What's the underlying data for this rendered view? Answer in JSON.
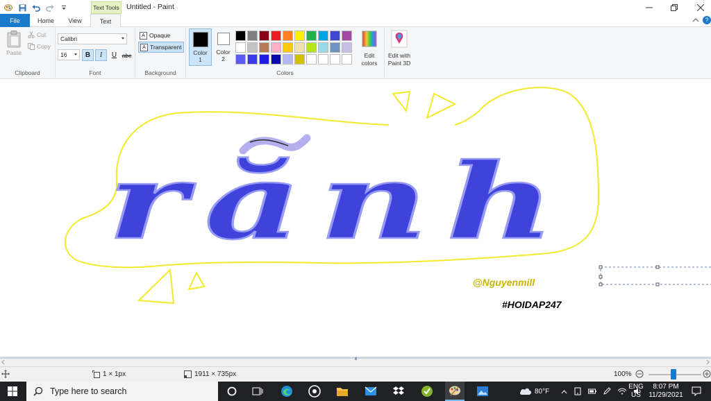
{
  "window": {
    "title": "Untitled - Paint",
    "context_tab": "Text Tools"
  },
  "tabs": [
    {
      "label": "File"
    },
    {
      "label": "Home"
    },
    {
      "label": "View"
    },
    {
      "label": "Text"
    }
  ],
  "ribbon": {
    "clipboard": {
      "paste": "Paste",
      "cut": "Cut",
      "copy": "Copy",
      "label": "Clipboard"
    },
    "font": {
      "family": "Calibri",
      "size": "16",
      "bold": "B",
      "italic": "I",
      "underline": "U",
      "strike": "abc",
      "label": "Font"
    },
    "background": {
      "opaque": "Opaque",
      "transparent": "Transparent",
      "label": "Background"
    },
    "colors": {
      "color1_line1": "Color",
      "color1_line2": "1",
      "color2_line1": "Color",
      "color2_line2": "2",
      "color1": "#000000",
      "color2": "#ffffff",
      "label": "Colors",
      "palette": [
        "#000000",
        "#7f7f7f",
        "#880015",
        "#ed1c24",
        "#ff7f27",
        "#fff200",
        "#22b14c",
        "#00a2e8",
        "#3f48cc",
        "#a349a4",
        "#ffffff",
        "#c3c3c3",
        "#b97a57",
        "#ffaec9",
        "#ffc90e",
        "#efe4b0",
        "#b5e61d",
        "#99d9ea",
        "#7092be",
        "#c8bfe7",
        "#5b5bf0",
        "#3a3ae8",
        "#1d1de0",
        "#0a0ab0",
        "#b7b7f4",
        "#d4c200",
        "#ffffff",
        "#ffffff",
        "#ffffff",
        "#ffffff"
      ],
      "edit_colors_line1": "Edit",
      "edit_colors_line2": "colors"
    },
    "paint3d": {
      "line1": "Edit with",
      "line2": "Paint 3D"
    }
  },
  "canvas": {
    "main_text": "rănh",
    "credit": "@Nguyenmill",
    "hashtag": "#HOIDAP247"
  },
  "status": {
    "selection_size": "1 × 1px",
    "image_size": "1911 × 735px",
    "zoom": "100%"
  },
  "taskbar": {
    "search_placeholder": "Type here to search",
    "weather": "80°F",
    "lang_line1": "ENG",
    "lang_line2": "US",
    "time": "8:07 PM",
    "date": "11/29/2021"
  }
}
